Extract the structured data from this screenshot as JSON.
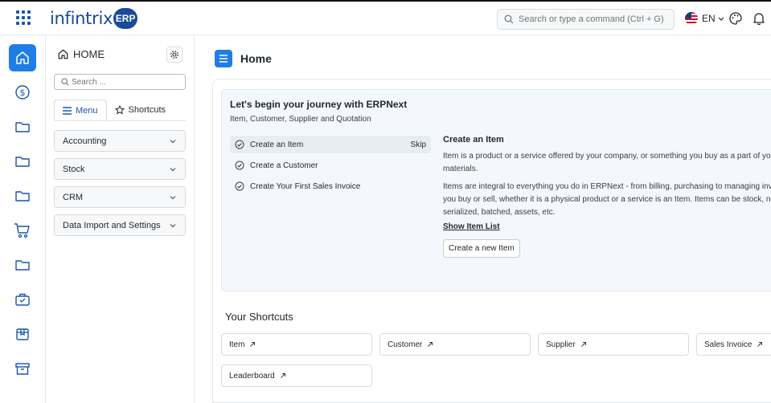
{
  "header": {
    "logo_text": "infintrix",
    "logo_badge": "ERP",
    "search_placeholder": "Search or type a command (Ctrl + G)",
    "language": "EN",
    "icons": [
      "grid-icon",
      "flag-icon",
      "chevron-down-icon",
      "palette-icon",
      "bell-icon"
    ]
  },
  "rail": {
    "items": [
      {
        "icon": "home-icon",
        "active": true
      },
      {
        "icon": "dollar-icon"
      },
      {
        "icon": "folder-icon"
      },
      {
        "icon": "folder-icon"
      },
      {
        "icon": "folder-icon"
      },
      {
        "icon": "cart-icon"
      },
      {
        "icon": "folder-icon"
      },
      {
        "icon": "briefcase-icon"
      },
      {
        "icon": "box-icon"
      },
      {
        "icon": "archive-icon"
      }
    ]
  },
  "sidebar": {
    "title": "HOME",
    "search_placeholder": "Search ...",
    "tabs": [
      {
        "label": "Menu",
        "active": true
      },
      {
        "label": "Shortcuts"
      }
    ],
    "items": [
      {
        "label": "Accounting"
      },
      {
        "label": "Stock"
      },
      {
        "label": "CRM"
      },
      {
        "label": "Data Import and Settings"
      }
    ]
  },
  "main": {
    "title": "Home",
    "onboarding": {
      "title": "Let's begin your journey with ERPNext",
      "subtitle": "Item, Customer, Supplier and Quotation",
      "steps": [
        {
          "label": "Create an Item",
          "active": true,
          "action": "Skip"
        },
        {
          "label": "Create a Customer"
        },
        {
          "label": "Create Your First Sales Invoice"
        }
      ],
      "detail": {
        "title": "Create an Item",
        "p1_line1": "Item is a product or a service offered by your company, or something you buy as a part of your",
        "p1_line2": "materials.",
        "p2_line1": "Items are integral to everything you do in ERPNext - from billing, purchasing to managing inve",
        "p2_line2": "you buy or sell, whether it is a physical product or a service is an Item. Items can be stock, non",
        "p2_line3": "serialized, batched, assets, etc.",
        "link": "Show Item List",
        "button": "Create a new Item"
      }
    },
    "shortcuts": {
      "title": "Your Shortcuts",
      "items": [
        {
          "label": "Item"
        },
        {
          "label": "Customer"
        },
        {
          "label": "Supplier"
        },
        {
          "label": "Sales Invoice"
        },
        {
          "label": "Leaderboard"
        }
      ]
    }
  },
  "colors": {
    "brand": "#1a4a9c",
    "accent": "#1f7ee6",
    "onboard_bg": "#f4f8fc"
  }
}
